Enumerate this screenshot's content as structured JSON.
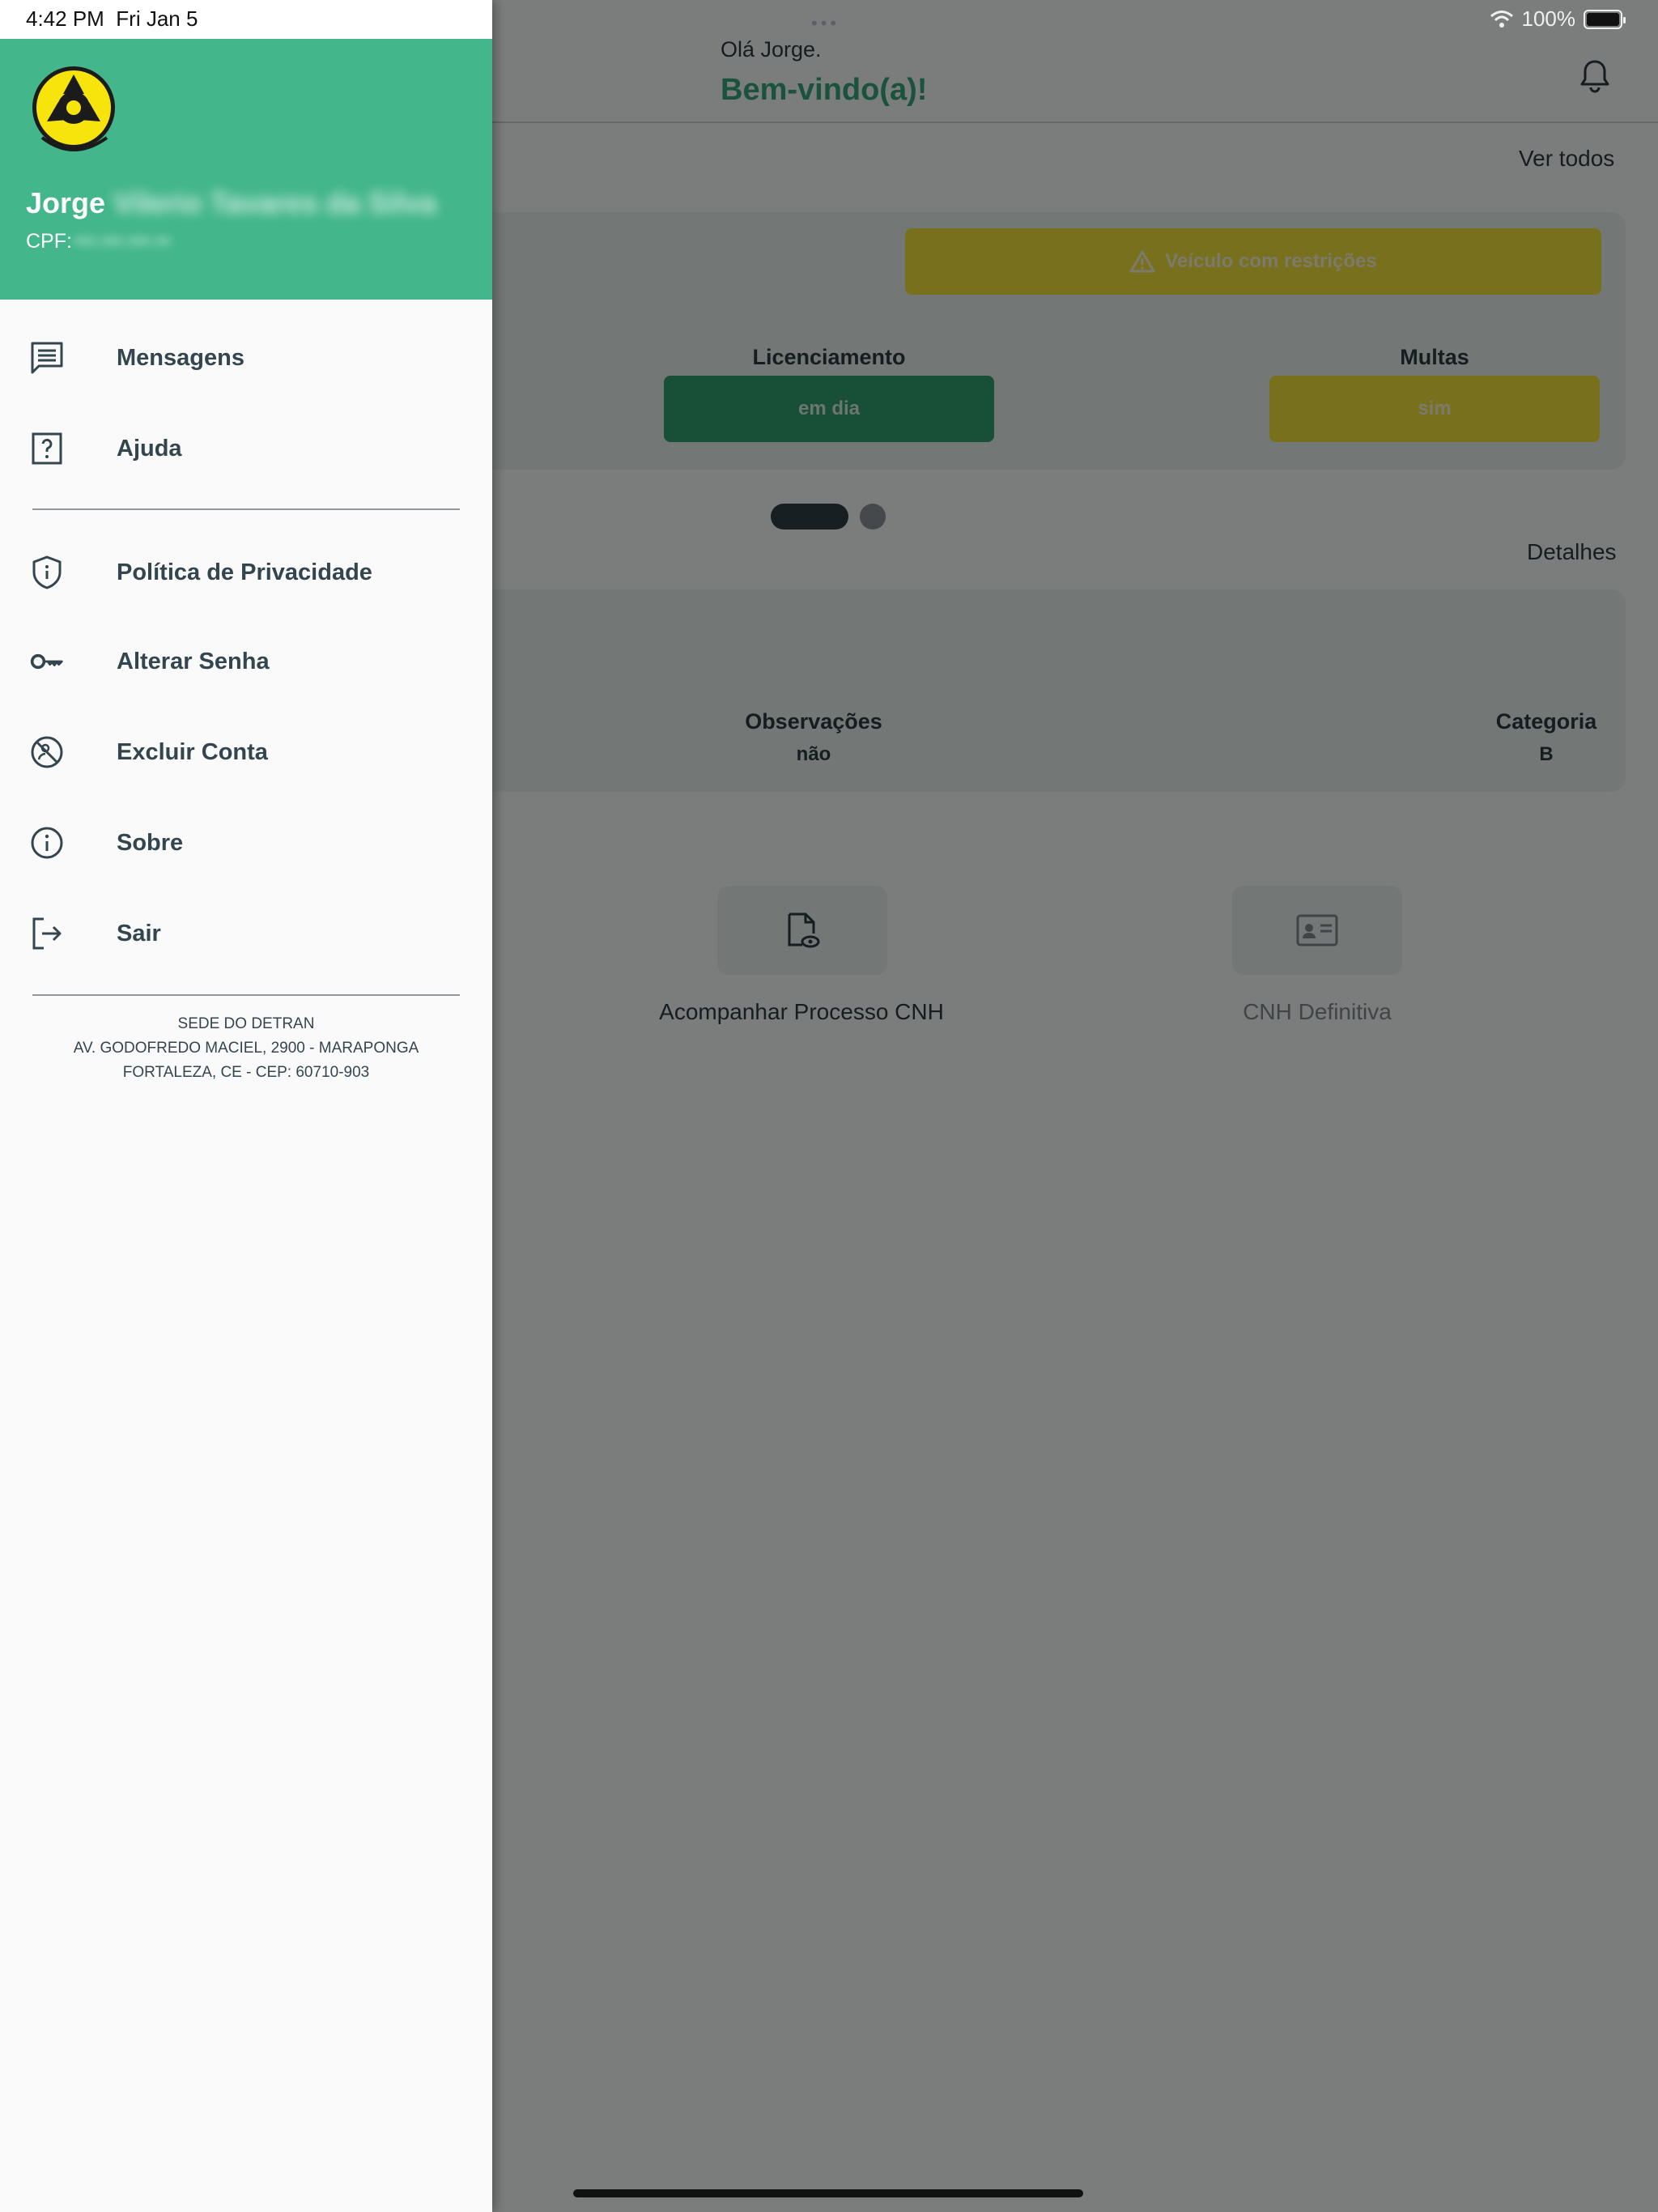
{
  "status_bar": {
    "time": "4:42 PM",
    "date": "Fri Jan 5",
    "battery": "100%",
    "multitask_dots": "•••"
  },
  "header": {
    "greeting": "Olá Jorge.",
    "welcome": "Bem-vindo(a)!"
  },
  "vehicle": {
    "see_all": "Ver todos",
    "warning": "Veículo com restrições",
    "licensing_label": "Licenciamento",
    "licensing_value": "em dia",
    "fines_label": "Multas",
    "fines_value": "sim"
  },
  "cnh": {
    "details": "Detalhes",
    "observations_label": "Observações",
    "observations_value": "não",
    "category_label": "Categoria",
    "category_value": "B"
  },
  "shortcuts": [
    {
      "label": "Acompanhar Processo CNH",
      "icon": "document-eye-icon"
    },
    {
      "label": "CNH Definitiva",
      "icon": "id-card-icon"
    }
  ],
  "drawer": {
    "logo_text": "DETRAN-CE",
    "user_first_name": "Jorge",
    "user_rest_name": "Vilerio Tavares da Silva",
    "cpf_label": "CPF:",
    "cpf_value": "•••.•••.•••-••",
    "menu": [
      {
        "label": "Mensagens",
        "icon": "messages-icon"
      },
      {
        "label": "Ajuda",
        "icon": "help-icon"
      },
      {
        "label": "Política de Privacidade",
        "icon": "shield-info-icon"
      },
      {
        "label": "Alterar Senha",
        "icon": "key-icon"
      },
      {
        "label": "Excluir Conta",
        "icon": "delete-account-icon"
      },
      {
        "label": "Sobre",
        "icon": "info-icon"
      },
      {
        "label": "Sair",
        "icon": "logout-icon"
      }
    ],
    "footer": {
      "line1": "SEDE DO DETRAN",
      "line2": "AV. GODOFREDO MACIEL, 2900 - MARAPONGA",
      "line3": "FORTALEZA, CE - CEP: 60710-903"
    }
  },
  "colors": {
    "brand_green": "#43b68b",
    "warning_yellow": "#f3e03b",
    "ok_green": "#2fa06c",
    "text_dark": "#33464f"
  }
}
